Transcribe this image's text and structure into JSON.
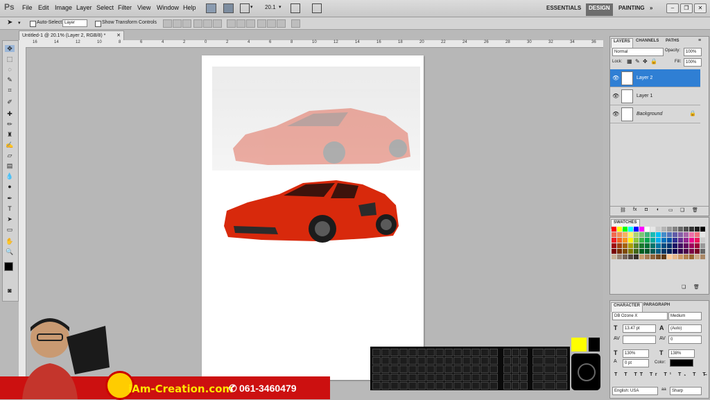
{
  "menubar": {
    "app_logo": "Ps",
    "menus": [
      "File",
      "Edit",
      "Image",
      "Layer",
      "Select",
      "Filter",
      "View",
      "Window",
      "Help"
    ],
    "zoom": "20.1",
    "workspaces": {
      "essentials": "ESSENTIALS",
      "design": "DESIGN",
      "painting": "PAINTING",
      "more": "»"
    }
  },
  "options": {
    "auto_select_label": "Auto-Select:",
    "auto_select_value": "Layer",
    "show_transform_label": "Show Transform Controls"
  },
  "document": {
    "tab_title": "Untitled-1 @ 20.1% (Layer 2, RGB/8) *",
    "ruler_top": [
      "16",
      "14",
      "12",
      "10",
      "8",
      "6",
      "4",
      "2",
      "0",
      "2",
      "4",
      "6",
      "8",
      "10",
      "12",
      "14",
      "16",
      "18",
      "20",
      "22",
      "24",
      "26",
      "28",
      "30",
      "32",
      "34",
      "36"
    ]
  },
  "layers_panel": {
    "tabs": [
      "LAYERS",
      "CHANNELS",
      "PATHS"
    ],
    "blend_mode": "Normal",
    "opacity_label": "Opacity:",
    "opacity": "100%",
    "lock_label": "Lock:",
    "fill_label": "Fill:",
    "fill": "100%",
    "layers": [
      {
        "name": "Layer 2",
        "selected": true
      },
      {
        "name": "Layer 1",
        "selected": false
      },
      {
        "name": "Background",
        "selected": false
      }
    ]
  },
  "swatches_panel": {
    "title": "SWATCHES"
  },
  "character_panel": {
    "tabs": [
      "CHARACTER",
      "PARAGRAPH"
    ],
    "font_family": "DB Ozone X",
    "font_style": "Medium",
    "font_size": "13.47 pt",
    "leading": "(Auto)",
    "tracking": "0",
    "vertical_scale": "130%",
    "horizontal_scale": "138%",
    "baseline_shift": "0 pt",
    "color_label": "Color:",
    "language": "English: USA",
    "antialias_label": "aa",
    "antialias": "Sharp"
  },
  "banner": {
    "brand": "iAm-Creation.com",
    "phone": "061-3460479"
  },
  "colors": {
    "accent_blue": "#2f7fd4",
    "banner_red": "#cc1010",
    "car_red": "#d8290c",
    "yellow": "#ffff00"
  }
}
